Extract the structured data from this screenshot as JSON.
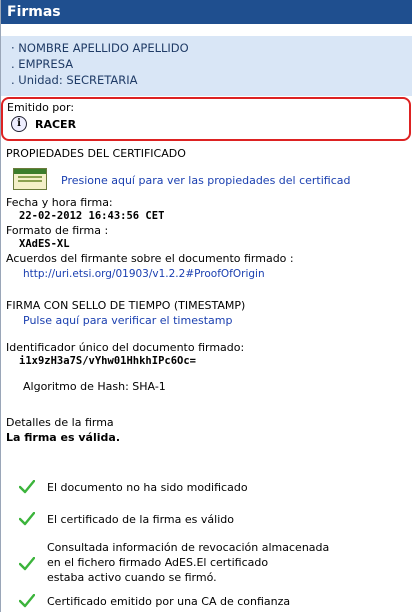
{
  "title": "Firmas",
  "signer": {
    "line1": "· NOMBRE APELLIDO APELLIDO",
    "line2": ". EMPRESA",
    "line3": ". Unidad: SECRETARIA"
  },
  "issued_by": {
    "label": "Emitido por:",
    "name": "RACER"
  },
  "cert_props": {
    "heading": "PROPIEDADES DEL CERTIFICADO",
    "link": "Presione aquí para ver las propiedades del certificad"
  },
  "date": {
    "label": "Fecha y hora firma:",
    "value": "22-02-2012 16:43:56 CET"
  },
  "format": {
    "label": "Formato de firma :",
    "value": "XAdES-XL"
  },
  "agreements": {
    "label": "Acuerdos del firmante sobre el documento firmado :",
    "link": "http://uri.etsi.org/01903/v1.2.2#ProofOfOrigin"
  },
  "timestamp": {
    "heading": "FIRMA CON SELLO DE TIEMPO (TIMESTAMP)",
    "link": "Pulse aquí para verificar el timestamp"
  },
  "identifier": {
    "label": "Identificador único del documento firmado:",
    "value": "i1x9zH3a7S/vYhw01HhkhIPc6Oc="
  },
  "hash": "Algoritmo de Hash: SHA-1",
  "details": {
    "label": "Detalles de la firma",
    "status": "La firma es válida."
  },
  "checks": [
    {
      "lines": [
        "El documento no ha sido modificado"
      ]
    },
    {
      "lines": [
        "El certificado de la firma es válido"
      ]
    },
    {
      "lines": [
        "Consultada información de revocación almacenada",
        "en el fichero firmado AdES.El certificado",
        "estaba activo cuando se firmó."
      ]
    },
    {
      "lines": [
        "Certificado emitido por una CA de confianza"
      ]
    }
  ],
  "colors": {
    "title_bg": "#1f4f8f",
    "signer_bg": "#d9e6f6",
    "link": "#1a3fb0",
    "check": "#3cb43c",
    "highlight_border": "#d22222"
  }
}
